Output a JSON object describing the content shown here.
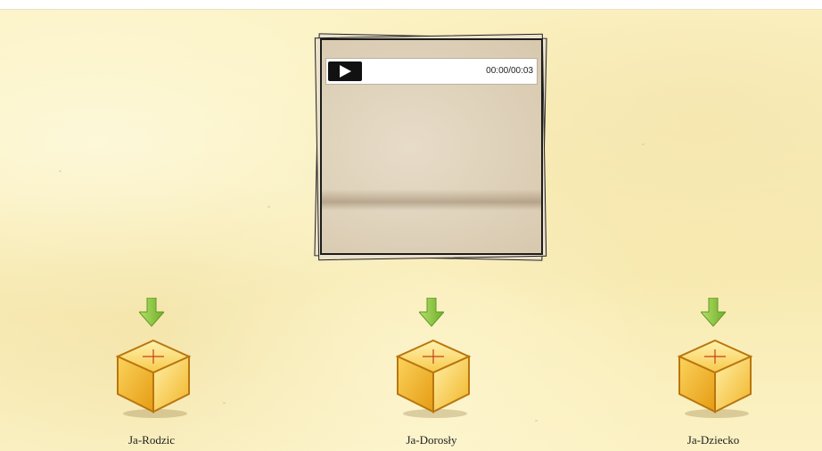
{
  "player": {
    "time_display": "00:00/00:03",
    "play_icon": "play-icon"
  },
  "items": [
    {
      "label": "Ja-Rodzic",
      "icon": "box-icon"
    },
    {
      "label": "Ja-Dorosły",
      "icon": "box-icon"
    },
    {
      "label": "Ja-Dziecko",
      "icon": "box-icon"
    }
  ],
  "colors": {
    "background": "#fbf1bf",
    "arrow": "#8cc63f",
    "box_gold": "#f5b820",
    "player_button": "#111111"
  }
}
